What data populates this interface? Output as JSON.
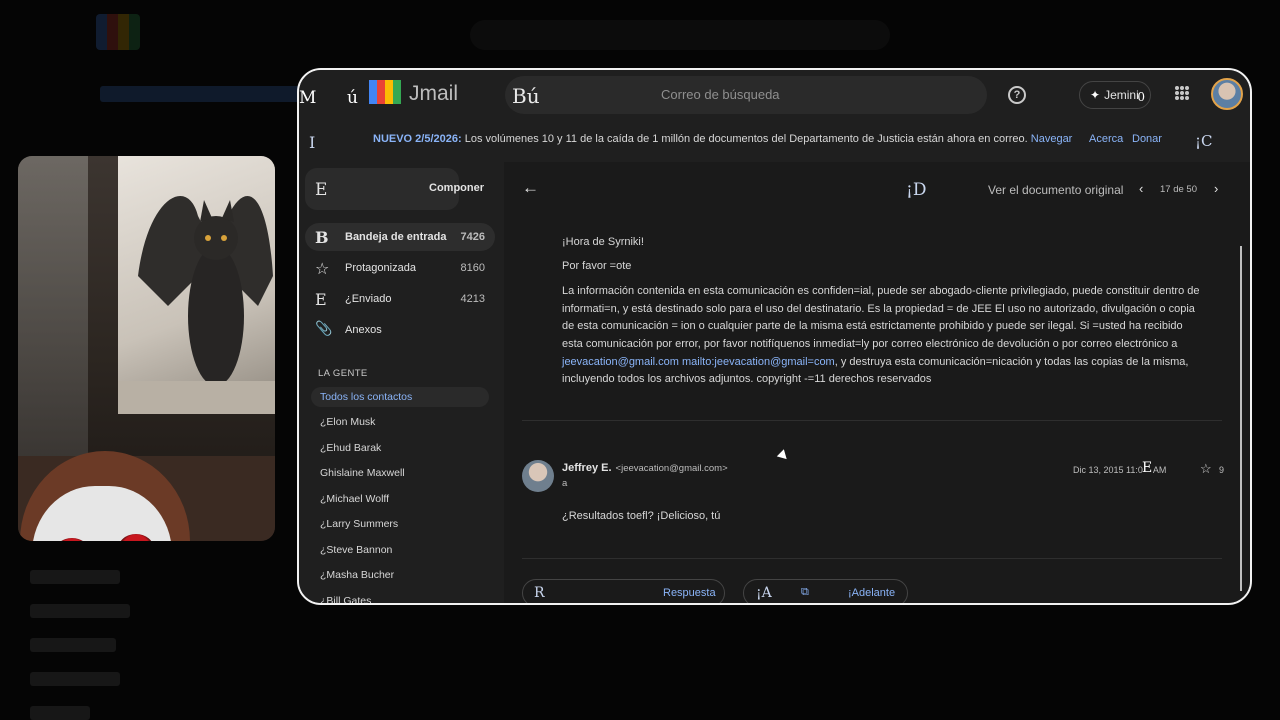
{
  "topbar": {
    "menu_glyph": "M",
    "menu_glyph2": "ú",
    "brand": "Jmail",
    "search_glyph": "Bú",
    "search_placeholder": "Correo de búsqueda",
    "help_symbol": "?",
    "gemini_label": "Jemini",
    "gemini_glyph": "0"
  },
  "banner": {
    "glyph_left": "I",
    "prefix": "NUEVO 2/5/2026:",
    "text": "Los volúmenes 10 y 11 de la caída de 1 millón de documentos del Departamento de Justicia están ahora en correo.",
    "link": "Navegar",
    "about": "Acerca",
    "donate": "Donar",
    "glyph_right": "¡C"
  },
  "sidebar": {
    "compose_glyph": "E",
    "compose_label": "Componer",
    "items": [
      {
        "icon": "B",
        "label": "Bandeja de entrada",
        "count": "7426"
      },
      {
        "icon": "☆",
        "label": "Protagonizada",
        "count": "8160"
      },
      {
        "icon": "E",
        "label": "¿Enviado",
        "count": "4213"
      },
      {
        "icon": "📎",
        "label": "Anexos",
        "count": ""
      }
    ],
    "section_title": "LA GENTE",
    "contacts": [
      "Todos los contactos",
      "¿Elon Musk",
      "¿Ehud Barak",
      "Ghislaine Maxwell",
      "¿Michael Wolff",
      "¿Larry Summers",
      "¿Steve Bannon",
      "¿Masha Bucher",
      "¿Bill Gates"
    ]
  },
  "toolbar": {
    "back_symbol": "←",
    "d_glyph": "¡D",
    "view_original": "Ver el documento original",
    "prev_symbol": "‹",
    "pager": "17 de 50",
    "next_symbol": "›"
  },
  "message1": {
    "greeting": "¡Hora de Syrniki!",
    "line2": "Por favor =ote",
    "legal_1": "La información contenida en esta comunicación es confiden=ial, puede ser abogado-cliente privilegiado, puede constituir dentro de informati=n, y está destinado solo para el uso del destinatario. Es la propiedad = de JEE El uso no autorizado, divulgación o copia de esta comunicación = ion o cualquier parte de la misma está estrictamente prohibido y puede ser ilegal. Si =usted ha recibido esta comunicación por error, por favor notifíquenos inmediat=ly por correo electrónico de devolución o por correo electrónico a",
    "link1": "jeevacation@gmail.com",
    "link2": "mailto:jeevacation@gmail=com",
    "legal_2": ", y destruya esta comunicación=nicación y todas las copias de la misma, incluyendo todos los archivos adjuntos. copyright -=11 derechos reservados"
  },
  "message2": {
    "sender_name": "Jeffrey E.",
    "sender_addr": "<jeevacation@gmail.com>",
    "to": "a",
    "date": "Dic 13, 2015 11:0",
    "date_glyph": "E",
    "date_suffix": "AM",
    "star_symbol": "☆",
    "star_count": "9",
    "body": "¿Resultados toefl? ¡Delicioso, tú"
  },
  "actions": {
    "reply_glyph": "R",
    "reply_label": "Respuesta",
    "fwd_glyph": "¡A",
    "fwd_icon": "⧉",
    "fwd_label": "¡Adelante"
  }
}
